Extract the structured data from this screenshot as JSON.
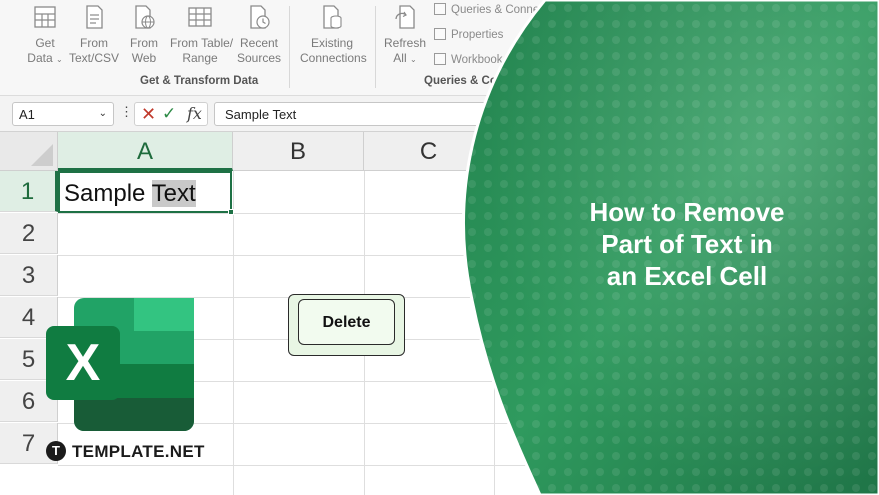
{
  "ribbon": {
    "buttons": [
      {
        "line1": "Get",
        "line2": "Data",
        "caret": "⌄",
        "icon": "database-table-icon"
      },
      {
        "line1": "From",
        "line2": "Text/CSV",
        "icon": "text-file-icon"
      },
      {
        "line1": "From",
        "line2": "Web",
        "icon": "globe-icon"
      },
      {
        "line1": "From Table/",
        "line2": "Range",
        "icon": "table-icon"
      },
      {
        "line1": "Recent",
        "line2": "Sources",
        "icon": "clock-file-icon"
      },
      {
        "line1": "Existing",
        "line2": "Connections",
        "icon": "connections-icon"
      },
      {
        "line1": "Refresh",
        "line2": "All",
        "caret": "⌄",
        "icon": "refresh-icon"
      }
    ],
    "small_items": [
      "Queries & Connections",
      "Properties",
      "Workbook Links"
    ],
    "group_get_transform": "Get & Transform Data",
    "group_queries": "Queries & Connections"
  },
  "formula_bar": {
    "name_box": "A1",
    "dropdown": "⌄",
    "dots": "⋮",
    "cancel": "✕",
    "enter": "✓",
    "fx": "fx",
    "content": "Sample Text"
  },
  "grid": {
    "columns": [
      "A",
      "B",
      "C"
    ],
    "rows": [
      "1",
      "2",
      "3",
      "4",
      "5",
      "6",
      "7"
    ],
    "a1_text_plain": "Sample ",
    "a1_text_highlighted": "Text"
  },
  "delete_key": {
    "label": "Delete"
  },
  "logo": {
    "letter": "X"
  },
  "brand": {
    "mark": "T",
    "name": "TEMPLATE.NET"
  },
  "title": {
    "line1": "How to Remove",
    "line2": "Part of Text in",
    "line3": "an Excel Cell"
  },
  "colors": {
    "excel_green": "#1e7145",
    "overlay_green": "#2f9a5e",
    "overlay_dark": "#1f7a48"
  }
}
